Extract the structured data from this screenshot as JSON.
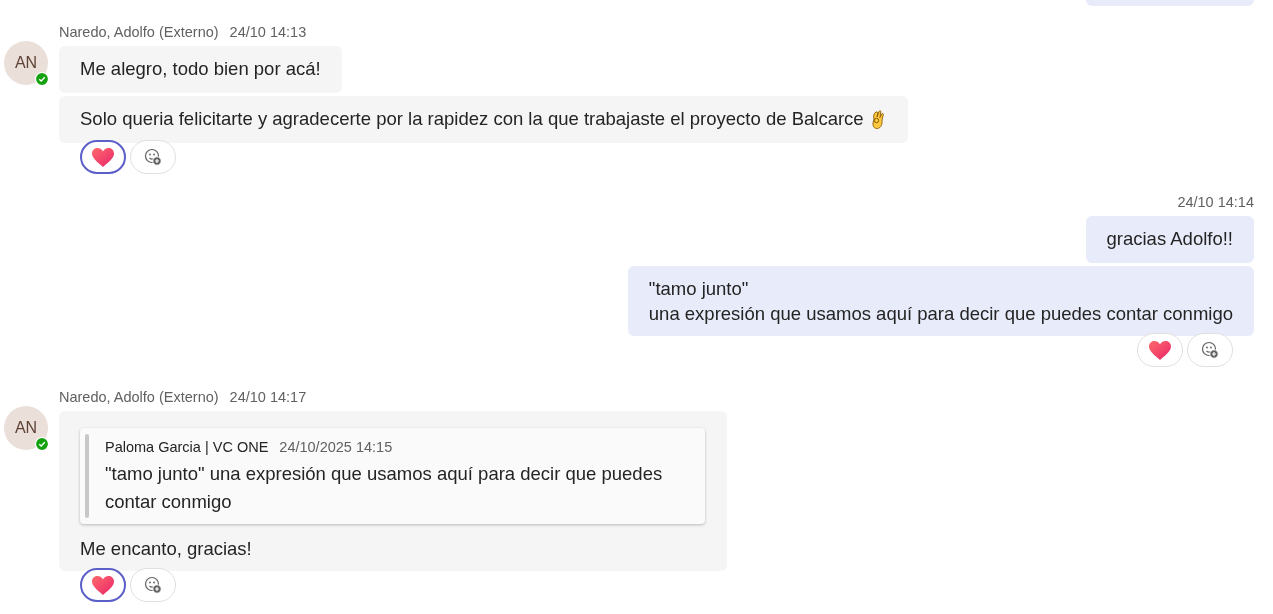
{
  "previous_bubble": {
    "visible": true
  },
  "groups": [
    {
      "kind": "incoming",
      "avatar": {
        "initials": "AN",
        "online": true
      },
      "sender": "Naredo, Adolfo (Externo)",
      "time": "24/10 14:13",
      "messages": [
        {
          "text": "Me alegro, todo bien por acá!"
        },
        {
          "text": "Solo queria felicitarte y agradecerte por la rapidez con la que trabajaste el proyecto de Balcarce",
          "kind": "ok_hand"
        }
      ],
      "reactions": [
        {
          "kind": "heart",
          "selected": true
        },
        {
          "kind": "add",
          "selected": false
        }
      ]
    },
    {
      "kind": "outgoing",
      "time": "24/10 14:14",
      "messages": [
        {
          "text": "gracias Adolfo!!"
        },
        {
          "lines": [
            "\"tamo junto\"",
            "una expresión que usamos aquí para decir que puedes contar conmigo"
          ]
        }
      ],
      "reactions": [
        {
          "kind": "heart",
          "selected": false
        },
        {
          "kind": "add",
          "selected": false
        }
      ]
    },
    {
      "kind": "incoming",
      "avatar": {
        "initials": "AN",
        "online": true
      },
      "sender": "Naredo, Adolfo (Externo)",
      "time": "24/10 14:17",
      "messages": [
        {
          "quote": {
            "author": "Paloma Garcia | VC ONE",
            "time": "24/10/2025 14:15",
            "text": "\"tamo junto\" una expresión que usamos aquí para decir que puedes contar conmigo"
          },
          "text": "Me encanto, gracias!"
        }
      ],
      "reactions": [
        {
          "kind": "heart",
          "selected": true
        },
        {
          "kind": "add",
          "selected": false
        }
      ]
    }
  ]
}
